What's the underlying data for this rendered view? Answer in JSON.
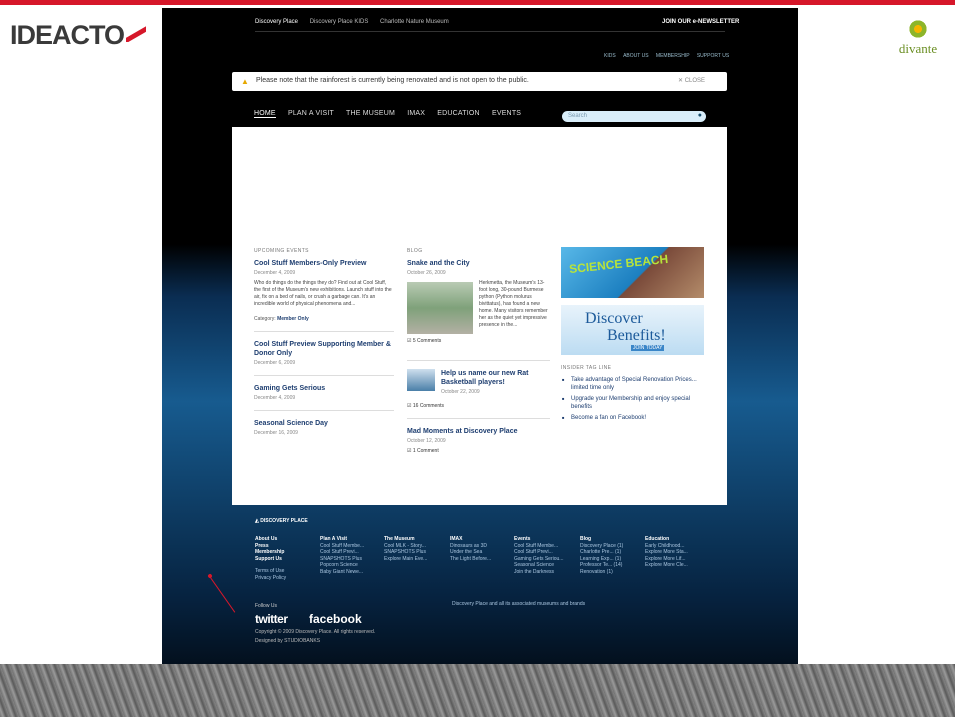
{
  "slide": {
    "brand_left": "IDEACTO",
    "brand_right": "divante"
  },
  "site": {
    "utility_nav": [
      "Discovery Place",
      "Discovery Place KIDS",
      "Charlotte Nature Museum"
    ],
    "join_link": "JOIN OUR e-NEWSLETTER",
    "quick_links": [
      "KIDS",
      "ABOUT US",
      "MEMBERSHIP",
      "SUPPORT US"
    ],
    "notice": "Please note that the rainforest is currently being renovated and is not open to the public.",
    "notice_close": "CLOSE",
    "main_nav": [
      "HOME",
      "PLAN A VISIT",
      "THE MUSEUM",
      "IMAX",
      "EDUCATION",
      "EVENTS"
    ],
    "search_placeholder": "Search",
    "upcoming": {
      "label": "UPCOMING EVENTS",
      "featured": {
        "title": "Cool Stuff Members-Only Preview",
        "date": "December 4, 2009",
        "text": "Who do things do the things they do? Find out at Cool Stuff, the first of the Museum's new exhibitions. Launch stuff into the air, fix on a bed of nails, or crush a garbage can. It's an incredible world of physical phenomena and...",
        "meta_label": "Category:",
        "meta_value": "Member Only"
      },
      "items": [
        {
          "title": "Cool Stuff Preview Supporting Member & Donor Only",
          "date": "December 6, 2009"
        },
        {
          "title": "Gaming Gets Serious",
          "date": "December 4, 2009"
        },
        {
          "title": "Seasonal Science Day",
          "date": "December 16, 2009"
        }
      ]
    },
    "blog": {
      "label": "BLOG",
      "post1": {
        "title": "Snake and the City",
        "date": "October 26, 2009",
        "text": "Herkmetta, the Museum's 13-foot long, 30-pound Burmese python (Python molurus bivittatus), has found a new home. Many visitors remember her as the quiet yet impressive presence in the...",
        "comments": "5 Comments"
      },
      "post2": {
        "title": "Help us name our new Rat Basketball players!",
        "date": "October 22, 2009",
        "comments": "16 Comments"
      },
      "post3": {
        "title": "Mad Moments at Discovery Place",
        "date": "October 12, 2009",
        "comments": "1 Comment"
      }
    },
    "ads": {
      "ad1_text": "SCIENCE BEACH",
      "ad2_line1": "Discover",
      "ad2_line2": "Benefits!",
      "ad2_cta": "JOIN TODAY"
    },
    "insider": {
      "label": "INSIDER TAG LINE",
      "tips": [
        "Take advantage of Special Renovation Prices... limited time only",
        "Upgrade your Membership and enjoy special benefits",
        "Become a fan on Facebook!"
      ]
    },
    "footer": {
      "title": "DISCOVERY PLACE",
      "cols": [
        {
          "head": "About Us",
          "items": [
            "Press",
            "Membership",
            "Support Us",
            "",
            "Terms of Use",
            "Privacy Policy"
          ]
        },
        {
          "head": "Plan A Visit",
          "items": [
            "Cool Stuff Membe...",
            "Cool Stuff Previ...",
            "SNAPSHOTS Plus",
            "Popcorn Science",
            "Baby Giant Newe..."
          ]
        },
        {
          "head": "The Museum",
          "items": [
            "Cool MLK - Story...",
            "SNAPSHOTS Plus",
            "Explore Main Eve..."
          ]
        },
        {
          "head": "IMAX",
          "items": [
            "Dinosaurs as 3D",
            "Under the Sea",
            "The Light Before..."
          ]
        },
        {
          "head": "Events",
          "items": [
            "Cool Stuff Membe...",
            "Cool Stuff Previ...",
            "Gaming Gets Seriou...",
            "Seasonal Science",
            "Join the Darkness"
          ]
        },
        {
          "head": "Blog",
          "items": [
            "Discovery Place (1)",
            "Charlotte Pre... (1)",
            "Learning Exp... (1)",
            "Professor Te... (14)",
            "Renovation (1)"
          ]
        },
        {
          "head": "Education",
          "items": [
            "Early Childhood...",
            "Explore More Sta...",
            "Explore More Lif...",
            "Explore More Cle..."
          ]
        }
      ],
      "follow_label": "Follow Us",
      "twitter": "twitter",
      "facebook": "facebook",
      "note": "Discovery Place and all its associated museums and brands",
      "copyright": "Copyright © 2009 Discovery Place. All rights reserved.",
      "designed": "Designed by STUDIOBANKS"
    }
  },
  "colors": {
    "accent": "#d6172a",
    "link": "#1e3e70",
    "nav_bg": "#000000",
    "footer_bg": "#175b8f"
  }
}
